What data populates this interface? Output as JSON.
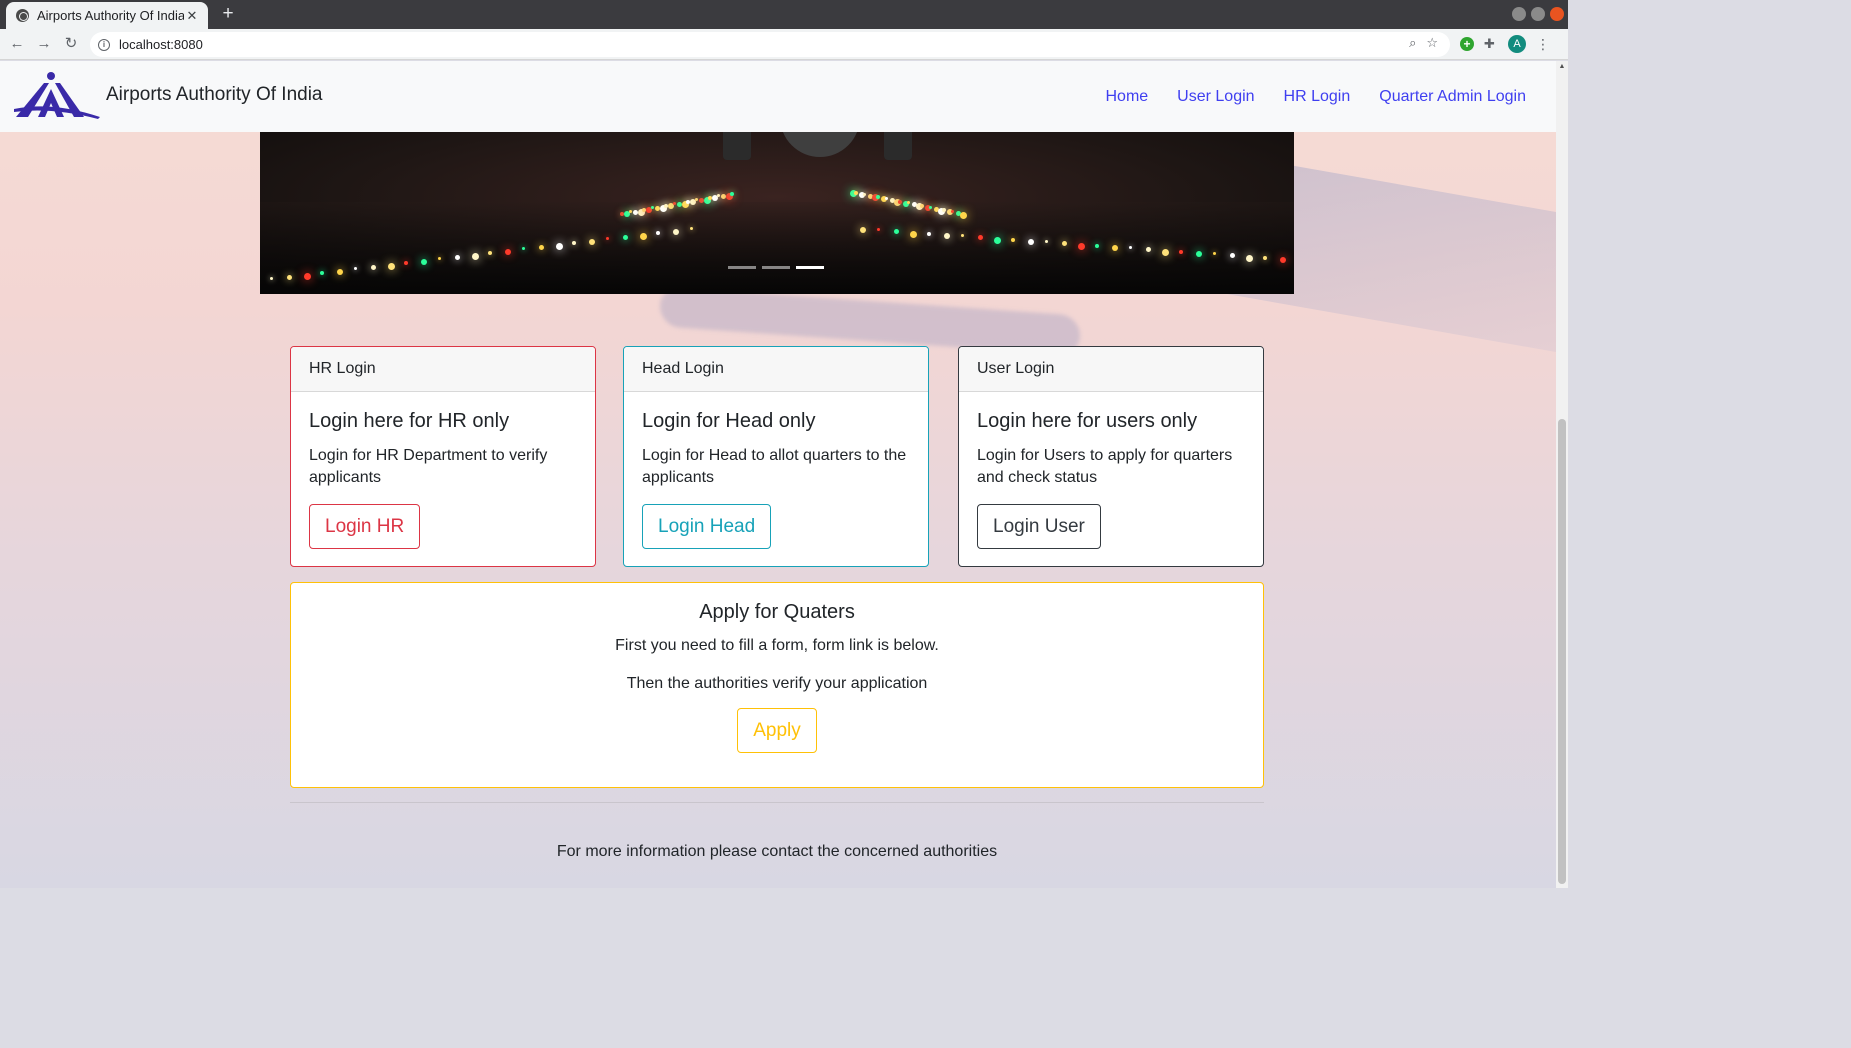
{
  "browser": {
    "tab_title": "Airports Authority Of India",
    "tab_close": "✕",
    "new_tab": "+",
    "url": "localhost:8080",
    "avatar_letter": "A"
  },
  "site": {
    "brand": "Airports Authority Of India",
    "nav": [
      "Home",
      "User Login",
      "HR Login",
      "Quarter Admin Login"
    ]
  },
  "carousel": {
    "slide_count": 3,
    "active_index": 2
  },
  "cards": {
    "hr": {
      "header": "HR Login",
      "title": "Login here for HR only",
      "text": "Login for HR Department to verify applicants",
      "button": "Login HR"
    },
    "head": {
      "header": "Head Login",
      "title": "Login for Head only",
      "text": "Login for Head to allot quarters to the applicants",
      "button": "Login Head"
    },
    "user": {
      "header": "User Login",
      "title": "Login here for users only",
      "text": "Login for Users to apply for quarters and check status",
      "button": "Login User"
    }
  },
  "apply": {
    "title": "Apply for Quaters",
    "line1": "First you need to fill a form, form link is below.",
    "line2": "Then the authorities verify your application",
    "button": "Apply"
  },
  "footer": {
    "text": "For more information please contact the concerned authorities"
  },
  "colors": {
    "danger": "#dc3545",
    "info": "#17a2b8",
    "dark": "#343a40",
    "warning": "#ffc107",
    "link": "#3f3ff0",
    "logo": "#3a2aa8"
  }
}
